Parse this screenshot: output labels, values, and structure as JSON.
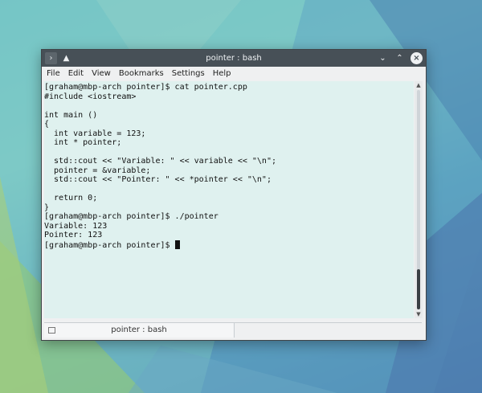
{
  "window": {
    "title": "pointer : bash",
    "pin_icon": "pin-icon",
    "terminal_icon": "terminal-prompt-icon",
    "controls": [
      "chevron-down-icon",
      "chevron-up-icon",
      "close-icon"
    ]
  },
  "menubar": {
    "items": [
      "File",
      "Edit",
      "View",
      "Bookmarks",
      "Settings",
      "Help"
    ]
  },
  "terminal": {
    "lines": [
      "[graham@mbp-arch pointer]$ cat pointer.cpp",
      "#include <iostream>",
      "",
      "int main ()",
      "{",
      "  int variable = 123;",
      "  int * pointer;",
      "",
      "  std::cout << \"Variable: \" << variable << \"\\n\";",
      "  pointer = &variable;",
      "  std::cout << \"Pointer: \" << *pointer << \"\\n\";",
      "",
      "  return 0;",
      "}",
      "[graham@mbp-arch pointer]$ ./pointer",
      "Variable: 123",
      "Pointer: 123"
    ],
    "prompt": "[graham@mbp-arch pointer]$ ",
    "scroll_position": 1.0
  },
  "tabbar": {
    "tab_label": "pointer : bash"
  },
  "colors": {
    "titlebar": "#475057",
    "terminal_bg": "#dff1ef",
    "terminal_fg": "#111111"
  }
}
